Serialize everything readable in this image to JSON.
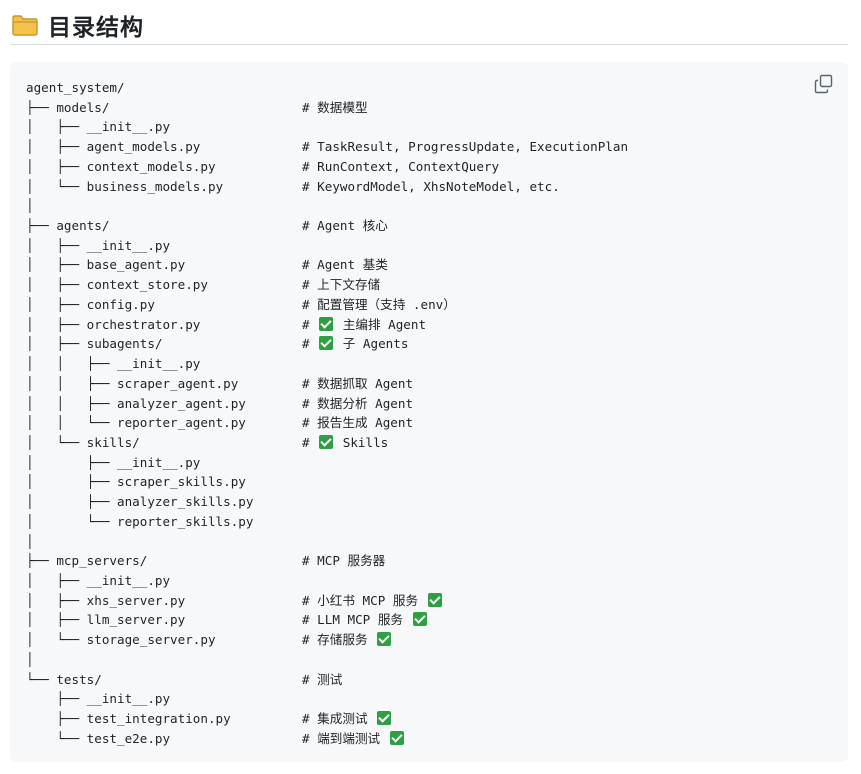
{
  "heading": {
    "icon": "folder-icon",
    "title": "目录结构"
  },
  "code": {
    "copy_icon": "copy-icon",
    "lines": [
      {
        "t": "agent_system/",
        "c": "",
        "k": ""
      },
      {
        "t": "├── models/",
        "c": "# 数据模型",
        "k": ""
      },
      {
        "t": "│   ├── __init__.py",
        "c": "",
        "k": ""
      },
      {
        "t": "│   ├── agent_models.py",
        "c": "# TaskResult, ProgressUpdate, ExecutionPlan",
        "k": ""
      },
      {
        "t": "│   ├── context_models.py",
        "c": "# RunContext, ContextQuery",
        "k": ""
      },
      {
        "t": "│   └── business_models.py",
        "c": "# KeywordModel, XhsNoteModel, etc.",
        "k": ""
      },
      {
        "t": "│",
        "c": "",
        "k": ""
      },
      {
        "t": "├── agents/",
        "c": "# Agent 核心",
        "k": ""
      },
      {
        "t": "│   ├── __init__.py",
        "c": "",
        "k": ""
      },
      {
        "t": "│   ├── base_agent.py",
        "c": "# Agent 基类",
        "k": ""
      },
      {
        "t": "│   ├── context_store.py",
        "c": "# 上下文存储",
        "k": ""
      },
      {
        "t": "│   ├── config.py",
        "c": "# 配置管理（支持 .env）",
        "k": ""
      },
      {
        "t": "│   ├── orchestrator.py",
        "c": "# ",
        "k": "pre",
        "a": " 主编排 Agent"
      },
      {
        "t": "│   ├── subagents/",
        "c": "# ",
        "k": "pre",
        "a": " 子 Agents"
      },
      {
        "t": "│   │   ├── __init__.py",
        "c": "",
        "k": ""
      },
      {
        "t": "│   │   ├── scraper_agent.py",
        "c": "# 数据抓取 Agent",
        "k": ""
      },
      {
        "t": "│   │   ├── analyzer_agent.py",
        "c": "# 数据分析 Agent",
        "k": ""
      },
      {
        "t": "│   │   └── reporter_agent.py",
        "c": "# 报告生成 Agent",
        "k": ""
      },
      {
        "t": "│   └── skills/",
        "c": "# ",
        "k": "pre",
        "a": " Skills"
      },
      {
        "t": "│       ├── __init__.py",
        "c": "",
        "k": ""
      },
      {
        "t": "│       ├── scraper_skills.py",
        "c": "",
        "k": ""
      },
      {
        "t": "│       ├── analyzer_skills.py",
        "c": "",
        "k": ""
      },
      {
        "t": "│       └── reporter_skills.py",
        "c": "",
        "k": ""
      },
      {
        "t": "│",
        "c": "",
        "k": ""
      },
      {
        "t": "├── mcp_servers/",
        "c": "# MCP 服务器",
        "k": ""
      },
      {
        "t": "│   ├── __init__.py",
        "c": "",
        "k": ""
      },
      {
        "t": "│   ├── xhs_server.py",
        "c": "# 小红书 MCP 服务 ",
        "k": "post"
      },
      {
        "t": "│   ├── llm_server.py",
        "c": "# LLM MCP 服务 ",
        "k": "post"
      },
      {
        "t": "│   └── storage_server.py",
        "c": "# 存储服务 ",
        "k": "post"
      },
      {
        "t": "│",
        "c": "",
        "k": ""
      },
      {
        "t": "└── tests/",
        "c": "# 测试",
        "k": ""
      },
      {
        "t": "    ├── __init__.py",
        "c": "",
        "k": ""
      },
      {
        "t": "    ├── test_integration.py",
        "c": "# 集成测试 ",
        "k": "post"
      },
      {
        "t": "    └── test_e2e.py",
        "c": "# 端到端测试 ",
        "k": "post"
      }
    ]
  }
}
